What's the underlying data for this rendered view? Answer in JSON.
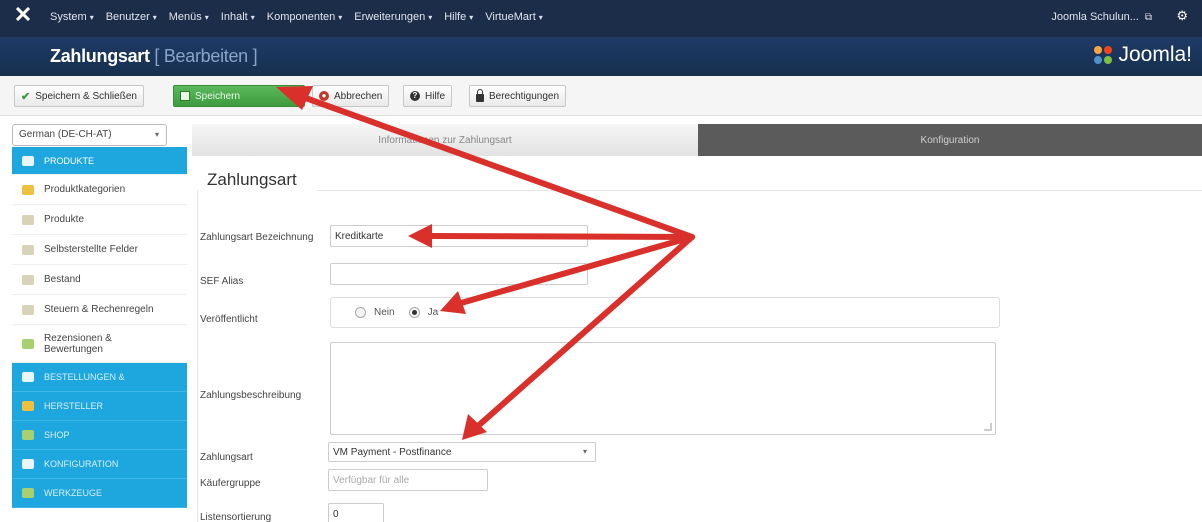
{
  "topbar": {
    "menu": [
      {
        "label": "System",
        "icon": "chevron-down-icon"
      },
      {
        "label": "Benutzer",
        "icon": "chevron-down-icon"
      },
      {
        "label": "Menüs",
        "icon": "chevron-down-icon"
      },
      {
        "label": "Inhalt",
        "icon": "chevron-down-icon"
      },
      {
        "label": "Komponenten",
        "icon": "chevron-down-icon"
      },
      {
        "label": "Erweiterungen",
        "icon": "chevron-down-icon"
      },
      {
        "label": "Hilfe",
        "icon": "chevron-down-icon"
      },
      {
        "label": "VirtueMart",
        "icon": "chevron-down-icon"
      }
    ],
    "user_label": "Joomla Schulun...",
    "external_link_icon": "external-link-icon",
    "settings_icon": "gear-icon"
  },
  "header": {
    "title": "Zahlungsart",
    "subtitle": "[ Bearbeiten ]",
    "brand": "Joomla!"
  },
  "toolbar": {
    "save_close_label": "Speichern & Schließen",
    "save_label": "Speichern",
    "cancel_label": "Abbrechen",
    "help_label": "Hilfe",
    "permissions_label": "Berechtigungen"
  },
  "sidebar": {
    "language": "German (DE-CH-AT)",
    "items": [
      {
        "label": "PRODUKTE",
        "type": "active",
        "icon": "products-icon"
      },
      {
        "label": "Produktkategorien",
        "type": "item",
        "icon": "folder-icon"
      },
      {
        "label": "Produkte",
        "type": "item",
        "icon": "list-icon"
      },
      {
        "label": "Selbsterstellte Felder",
        "type": "item",
        "icon": "custom-fields-icon"
      },
      {
        "label": "Bestand",
        "type": "item",
        "icon": "inventory-icon"
      },
      {
        "label": "Steuern & Rechenregeln",
        "type": "item",
        "icon": "tax-icon"
      },
      {
        "label": "Rezensionen & Bewertungen",
        "type": "item",
        "icon": "reviews-icon"
      },
      {
        "label": "BESTELLUNGEN &",
        "type": "section",
        "icon": "orders-icon"
      },
      {
        "label": "HERSTELLER",
        "type": "section",
        "icon": "manufacturer-icon"
      },
      {
        "label": "SHOP",
        "type": "section",
        "icon": "shop-icon"
      },
      {
        "label": "KONFIGURATION",
        "type": "section",
        "icon": "configuration-icon"
      },
      {
        "label": "WERKZEUGE",
        "type": "section",
        "icon": "tools-icon"
      }
    ]
  },
  "tabs": [
    {
      "label": "Informationen zur Zahlungsart",
      "active": true
    },
    {
      "label": "Konfiguration",
      "active": false
    }
  ],
  "form": {
    "fieldset_title": "Zahlungsart",
    "name_label": "Zahlungsart Bezeichnung",
    "name_value": "Kreditkarte",
    "alias_label": "SEF Alias",
    "alias_value": "",
    "published_label": "Veröffentlicht",
    "published_options": [
      "Nein",
      "Ja"
    ],
    "published_selected": "Ja",
    "description_label": "Zahlungsbeschreibung",
    "method_label": "Zahlungsart",
    "method_value": "VM Payment - Postfinance",
    "shoppergroup_label": "Käufergruppe",
    "shoppergroup_placeholder": "Verfügbar für alle",
    "ordering_label": "Listensortierung",
    "ordering_value": "0"
  },
  "colors": {
    "topbar": "#1c2d4a",
    "header": "#1e3a66",
    "sidebar_active": "#1ea7df",
    "save_button": "#4cae4c",
    "annotation_arrow": "#d9302c",
    "inactive_tab": "#5b5b5b"
  }
}
